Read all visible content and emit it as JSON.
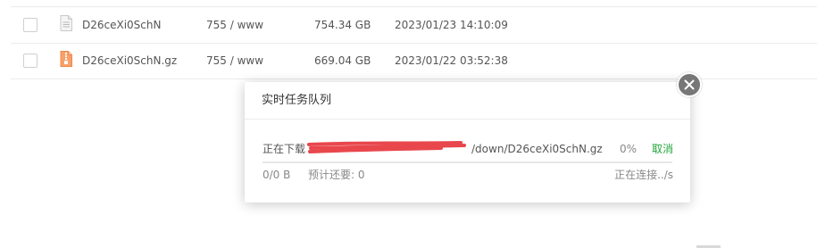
{
  "files": [
    {
      "name": "D26ceXi0SchN",
      "icon": "text-file-icon",
      "permission": "755 / www",
      "size": "754.34 GB",
      "modified": "2023/01/23 14:10:09"
    },
    {
      "name": "D26ceXi0SchN.gz",
      "icon": "archive-file-icon",
      "permission": "755 / www",
      "size": "669.04 GB",
      "modified": "2023/01/22 03:52:38"
    }
  ],
  "task_modal": {
    "title": "实时任务队列",
    "task": {
      "prefix": "正在下载",
      "path": "/down/D26ceXi0SchN.gz",
      "percent": "0%",
      "progress": 0,
      "cancel_label": "取消",
      "transferred": "0/0 B",
      "eta": "预计还要: 0",
      "speed": "正在连接../s"
    }
  },
  "colors": {
    "accent": "#20a53a",
    "redaction": "#e8474c",
    "archive_icon": "#f0884a"
  }
}
